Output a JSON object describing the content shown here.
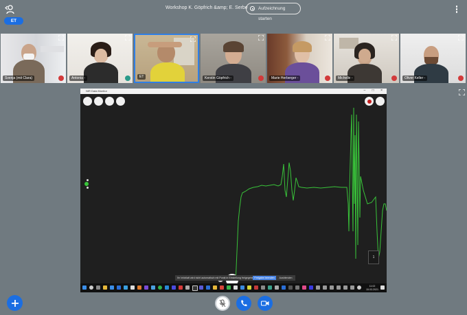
{
  "header": {
    "title": "Workshop K. Göpfrich &amp; E. Serbe",
    "record_label": "Aufzeichnung starten",
    "presenter_badge": "ET"
  },
  "participants": [
    {
      "name": "Svenja (mit Clara)"
    },
    {
      "name": "Antonia -"
    },
    {
      "name": "ET"
    },
    {
      "name": "Kerstin Göpfrich -"
    },
    {
      "name": "Marie Herberger -"
    },
    {
      "name": "Michelle -"
    },
    {
      "name": "Oliver Keller -"
    }
  ],
  "shared_app": {
    "window_title": "NIR Data Monitor",
    "window_controls": "– □ ×",
    "notification": "Ihr Infoblatt wird nicht automatisch mit Punkt in Einstellung freigegeben",
    "notification_primary": "Freigabe beenden",
    "notification_secondary": "Ausblenden",
    "time": "11:02",
    "date": "15.03.2021",
    "side_value": "1"
  },
  "colors": {
    "accent": "#1b6ee2",
    "signal": "#39c43a",
    "record": "#c41e1e"
  }
}
